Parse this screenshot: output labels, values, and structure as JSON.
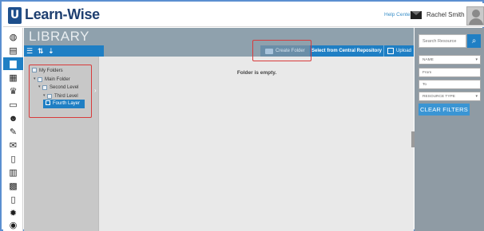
{
  "app": {
    "logo_mark": "U",
    "name": "Learn-Wise"
  },
  "header": {
    "help_label": "Help Center",
    "user_name": "Rachel Smith"
  },
  "sidebar": {
    "items": [
      {
        "icon": "dashboard-icon",
        "glyph": "◍"
      },
      {
        "icon": "catalog-icon",
        "glyph": "▤"
      },
      {
        "icon": "library-icon",
        "glyph": "▆",
        "active": true
      },
      {
        "icon": "grid-icon",
        "glyph": "▦"
      },
      {
        "icon": "trophy-icon",
        "glyph": "♛"
      },
      {
        "icon": "presentation-icon",
        "glyph": "▭"
      },
      {
        "icon": "users-icon",
        "glyph": "☻"
      },
      {
        "icon": "tag-icon",
        "glyph": "✎"
      },
      {
        "icon": "mail-icon",
        "glyph": "✉"
      },
      {
        "icon": "report-icon",
        "glyph": "▯"
      },
      {
        "icon": "bar-chart-icon",
        "glyph": "▥"
      },
      {
        "icon": "calendar-icon",
        "glyph": "▩"
      },
      {
        "icon": "tablet-icon",
        "glyph": "▯"
      },
      {
        "icon": "gear-icon",
        "glyph": "✹"
      },
      {
        "icon": "globe-icon",
        "glyph": "◉"
      }
    ]
  },
  "library": {
    "title": "LIBRARY",
    "actions": {
      "create_folder": "Create Folder",
      "select_central": "Select from Central Repository",
      "upload": "Upload"
    },
    "tree": [
      {
        "label": "My Folders",
        "level": 0,
        "toggle": ""
      },
      {
        "label": "Main Folder",
        "level": 1,
        "toggle": "▾"
      },
      {
        "label": "Second Level",
        "level": 2,
        "toggle": "▾"
      },
      {
        "label": "Third Level",
        "level": 3,
        "toggle": "▾"
      },
      {
        "label": "Fourth Layer",
        "level": 4,
        "toggle": "",
        "selected": true
      }
    ],
    "empty_message": "Folder is empty."
  },
  "filters": {
    "search_placeholder": "Search Resource",
    "name_placeholder": "NAME",
    "from_placeholder": "From",
    "to_placeholder": "To",
    "resource_type_placeholder": "RESOURCE TYPE",
    "clear_label": "CLEAR FILTERS"
  },
  "colors": {
    "primary": "#1f7fc4",
    "header_band": "#8fa1ad",
    "filter_panel": "#8f9ba4",
    "highlight": "#d83b3b",
    "logo": "#1e3f70"
  }
}
